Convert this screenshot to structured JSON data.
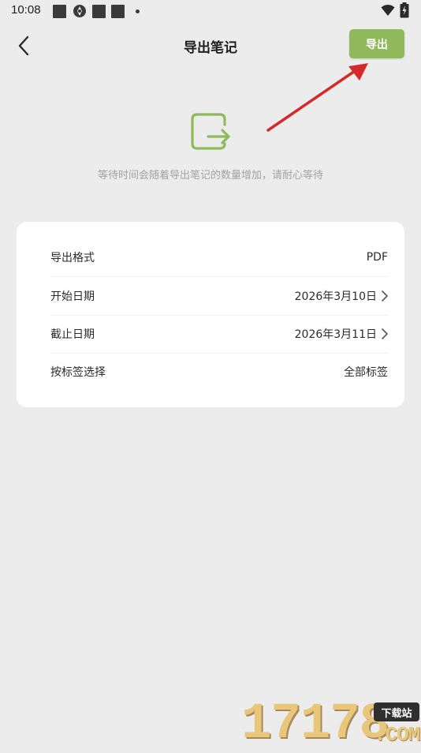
{
  "status_bar": {
    "time": "10:08",
    "icons": [
      "notification-square-icon",
      "swirl-icon",
      "notification-square-icon",
      "notification-square-icon",
      "dot-icon",
      "wifi-icon",
      "battery-charging-icon"
    ]
  },
  "header": {
    "title": "导出笔记",
    "back_icon": "chevron-left-icon",
    "export_label": "导出"
  },
  "hero": {
    "icon": "export-icon",
    "hint": "等待时间会随着导出笔记的数量增加，请耐心等待"
  },
  "settings": {
    "rows": [
      {
        "label": "导出格式",
        "value": "PDF",
        "has_chevron": false
      },
      {
        "label": "开始日期",
        "value": "2026年3月10日",
        "has_chevron": true
      },
      {
        "label": "截止日期",
        "value": "2026年3月11日",
        "has_chevron": true
      },
      {
        "label": "按标签选择",
        "value": "全部标签",
        "has_chevron": false
      }
    ]
  },
  "watermark": {
    "digits": "17178",
    "badge": "下载站",
    "domain": ".COM"
  },
  "colors": {
    "accent": "#8fb95a",
    "background": "#ececec",
    "card": "#ffffff",
    "hint_text": "#a3a3a3",
    "annotation_arrow": "#d42a2a"
  }
}
